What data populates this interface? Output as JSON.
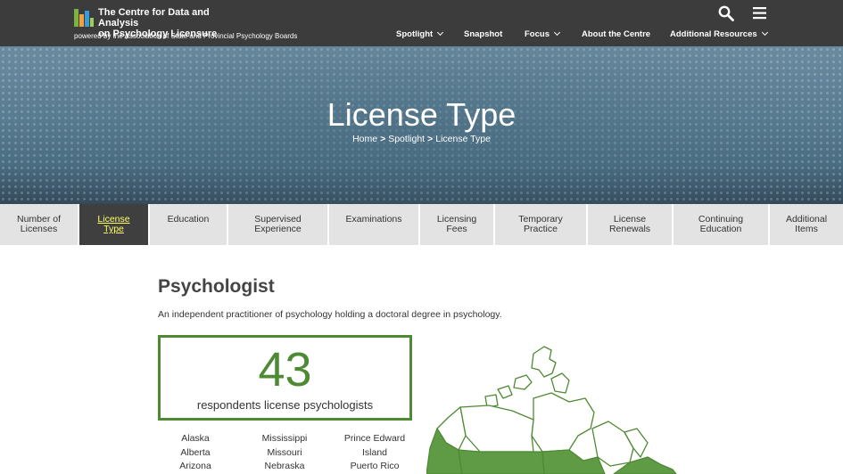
{
  "header": {
    "logo_line1": "The Centre for Data and Analysis",
    "logo_line2": "on Psychology Licensure",
    "powered_by": "powered by the Association of State and Provincial Psychology Boards",
    "nav": [
      {
        "label": "Spotlight",
        "dropdown": true
      },
      {
        "label": "Snapshot",
        "dropdown": false
      },
      {
        "label": "Focus",
        "dropdown": true
      },
      {
        "label": "About the Centre",
        "dropdown": false
      },
      {
        "label": "Additional Resources",
        "dropdown": true
      }
    ],
    "icons": [
      "search-icon",
      "menu-icon"
    ]
  },
  "hero": {
    "title": "License Type",
    "breadcrumb": [
      "Home",
      "Spotlight",
      "License Type"
    ],
    "separator": ">"
  },
  "tabs": [
    {
      "line1": "Number of",
      "line2": "Licenses",
      "active": false
    },
    {
      "line1": "License",
      "line2": "Type",
      "active": true
    },
    {
      "line1": "Education",
      "line2": "",
      "active": false
    },
    {
      "line1": "Supervised",
      "line2": "Experience",
      "active": false
    },
    {
      "line1": "Examinations",
      "line2": "",
      "active": false
    },
    {
      "line1": "Licensing",
      "line2": "Fees",
      "active": false
    },
    {
      "line1": "Temporary",
      "line2": "Practice",
      "active": false
    },
    {
      "line1": "License",
      "line2": "Renewals",
      "active": false
    },
    {
      "line1": "Continuing",
      "line2": "Education",
      "active": false
    },
    {
      "line1": "Additional",
      "line2": "Items",
      "active": false
    }
  ],
  "content": {
    "heading": "Psychologist",
    "description": "An independent practitioner of psychology holding a doctoral degree in psychology.",
    "stat_value": "43",
    "stat_label": "respondents license psychologists",
    "jurisdictions": {
      "col1": [
        "Alaska",
        "Alberta",
        "Arizona"
      ],
      "col2": [
        "Mississippi",
        "Missouri",
        "Nebraska"
      ],
      "col3": [
        "Prince Edward",
        "Island",
        "Puerto Rico"
      ]
    }
  },
  "colors": {
    "topbar": "#3c3c3c",
    "accent_green": "#4e8a33",
    "active_tab_bg": "#3f3f3f",
    "active_tab_text": "#ffff66",
    "tab_bg": "#e3e3e3"
  }
}
